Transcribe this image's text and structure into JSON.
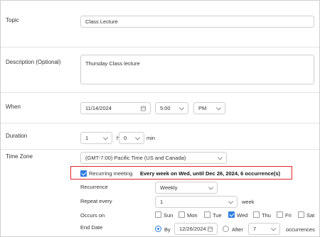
{
  "topic": {
    "label": "Topic",
    "value": "Class Lecture"
  },
  "description": {
    "label": "Description (Optional)",
    "value": "Thursday Class lecture"
  },
  "when": {
    "label": "When",
    "date": "11/14/2024",
    "time": "5:00",
    "ampm": "PM"
  },
  "duration": {
    "label": "Duration",
    "hours": "1",
    "hr_label": "hr",
    "minutes": "0",
    "min_label": "min"
  },
  "timezone": {
    "label": "Time Zone",
    "value": "(GMT-7:00) Pacific Time (US and Canada)"
  },
  "recurring": {
    "label": "Recurring meeting",
    "checked": true,
    "summary": "Every week on Wed, until Dec 26, 2024, 6 occurrence(s)"
  },
  "recurrence": {
    "label": "Recurrence",
    "value": "Weekly"
  },
  "repeat_every": {
    "label": "Repeat every",
    "value": "1",
    "unit": "week"
  },
  "occurs_on": {
    "label": "Occurs on",
    "days": [
      {
        "label": "Sun",
        "checked": false
      },
      {
        "label": "Mon",
        "checked": false
      },
      {
        "label": "Tue",
        "checked": false
      },
      {
        "label": "Wed",
        "checked": true
      },
      {
        "label": "Thu",
        "checked": false
      },
      {
        "label": "Fri",
        "checked": false
      },
      {
        "label": "Sat",
        "checked": false
      }
    ]
  },
  "end_date": {
    "label": "End Date",
    "by_label": "By",
    "by_date": "12/26/2024",
    "after_label": "After",
    "after_count": "7",
    "occurrences_label": "occurrences",
    "selected": "by"
  },
  "colors": {
    "accent": "#2f7de1",
    "highlight": "#e0262b"
  }
}
